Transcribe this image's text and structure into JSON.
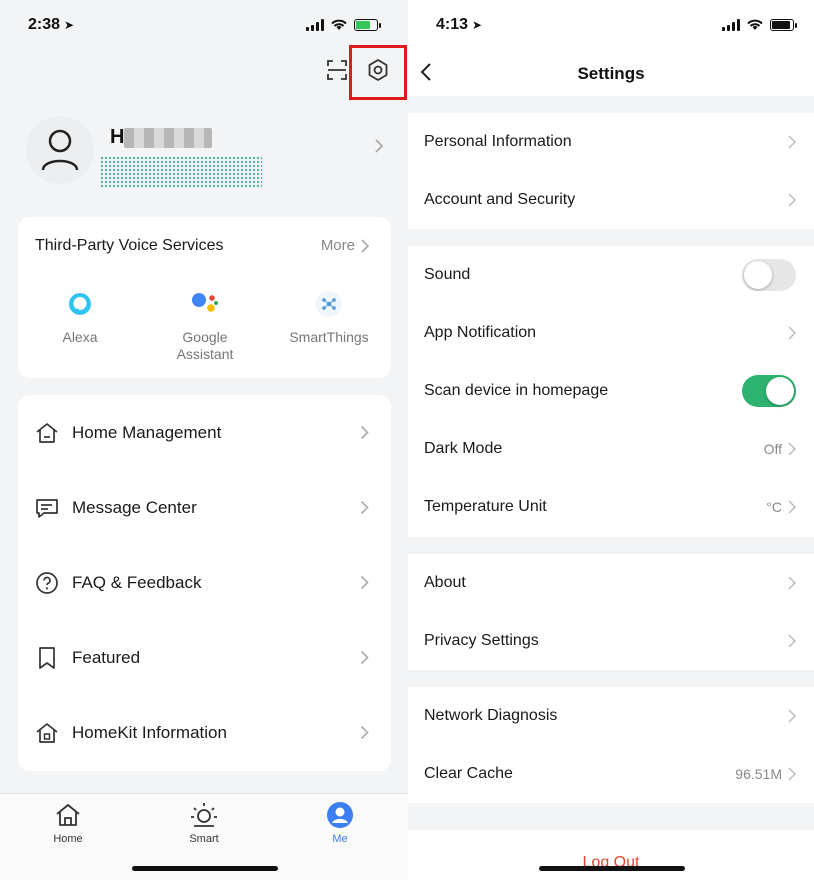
{
  "left_screen": {
    "status_bar": {
      "time": "2:38",
      "battery_color": "#35c759"
    },
    "profile": {
      "name_visible": "H"
    },
    "voice_services": {
      "title": "Third-Party Voice Services",
      "more": "More",
      "items": [
        {
          "label": "Alexa",
          "icon": "alexa-icon"
        },
        {
          "label": "Google\nAssistant",
          "icon": "google-assistant-icon"
        },
        {
          "label": "SmartThings",
          "icon": "smartthings-icon"
        }
      ]
    },
    "menu": [
      {
        "label": "Home Management",
        "icon": "home-icon"
      },
      {
        "label": "Message Center",
        "icon": "message-icon"
      },
      {
        "label": "FAQ & Feedback",
        "icon": "question-icon"
      },
      {
        "label": "Featured",
        "icon": "bookmark-icon"
      },
      {
        "label": "HomeKit Information",
        "icon": "homekit-icon"
      }
    ],
    "tabs": [
      {
        "label": "Home",
        "icon": "home-tab-icon",
        "active": false
      },
      {
        "label": "Smart",
        "icon": "sun-icon",
        "active": false
      },
      {
        "label": "Me",
        "icon": "person-icon",
        "active": true
      }
    ],
    "accent_color": "#3d7ef0"
  },
  "right_screen": {
    "status_bar": {
      "time": "4:13"
    },
    "title": "Settings",
    "groups": [
      [
        {
          "label": "Personal Information"
        },
        {
          "label": "Account and Security"
        }
      ],
      [
        {
          "label": "Sound",
          "toggle": "off"
        },
        {
          "label": "App Notification"
        },
        {
          "label": "Scan device in homepage",
          "toggle": "on"
        },
        {
          "label": "Dark Mode",
          "value": "Off"
        },
        {
          "label": "Temperature Unit",
          "value": "°C"
        }
      ],
      [
        {
          "label": "About"
        },
        {
          "label": "Privacy Settings"
        }
      ],
      [
        {
          "label": "Network Diagnosis"
        },
        {
          "label": "Clear Cache",
          "value": "96.51M"
        }
      ]
    ],
    "logout": "Log Out",
    "toggle_on_color": "#2db36f",
    "logout_color": "#e0452e"
  }
}
